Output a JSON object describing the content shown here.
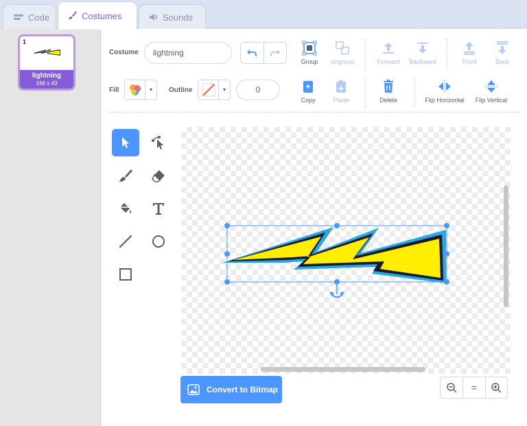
{
  "tabs": [
    {
      "label": "Code",
      "icon": "code-icon"
    },
    {
      "label": "Costumes",
      "icon": "paintbrush-icon",
      "active": true
    },
    {
      "label": "Sounds",
      "icon": "speaker-icon"
    }
  ],
  "costume_list": {
    "items": [
      {
        "index": "1",
        "name": "lightning",
        "size": "166 x 43",
        "selected": true
      }
    ]
  },
  "costume_name": {
    "label": "Costume",
    "value": "lightning"
  },
  "fill": {
    "label": "Fill"
  },
  "outline": {
    "label": "Outline",
    "width": "0"
  },
  "toolbar": {
    "group": "Group",
    "ungroup": "Ungroup",
    "forward": "Forward",
    "backward": "Backward",
    "front": "Front",
    "back": "Back",
    "copy": "Copy",
    "paste": "Paste",
    "delete": "Delete",
    "flip_horizontal": "Flip Horizontal",
    "flip_vertical": "Flip Vertical"
  },
  "convert_button": "Convert to Bitmap",
  "zoom": {
    "out": "−",
    "reset": "=",
    "in": "+"
  },
  "colors": {
    "accent": "#4c97ff",
    "selection": "#855cd6",
    "lightning_fill": "#ffee00",
    "lightning_outer": "#29a8e0",
    "lightning_inner": "#1a1a2e"
  }
}
